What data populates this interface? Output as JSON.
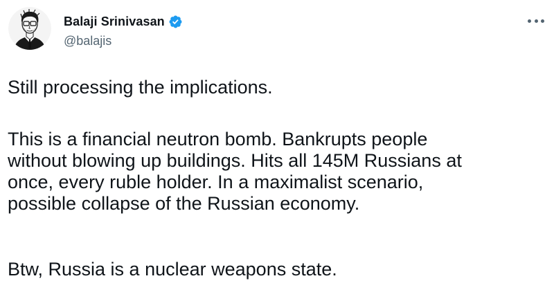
{
  "author": {
    "display_name": "Balaji Srinivasan",
    "handle": "@balajis",
    "verified": true,
    "avatar_icon": "sketch-portrait-avatar",
    "verified_icon": "verified-badge-icon"
  },
  "menu": {
    "more_icon": "more-options-icon"
  },
  "tweet": {
    "paragraphs": [
      [
        "Still processing the implications."
      ],
      [
        "This is a financial neutron bomb. Bankrupts people",
        "without blowing up buildings. Hits all 145M Russians at",
        "once, every ruble holder. In a maximalist scenario,",
        "possible collapse of the Russian economy."
      ],
      [
        "Btw, Russia is a nuclear weapons state."
      ]
    ]
  },
  "colors": {
    "text_primary": "#0f1419",
    "text_secondary": "#536471",
    "verified_blue": "#1d9bf0",
    "background": "#ffffff"
  }
}
